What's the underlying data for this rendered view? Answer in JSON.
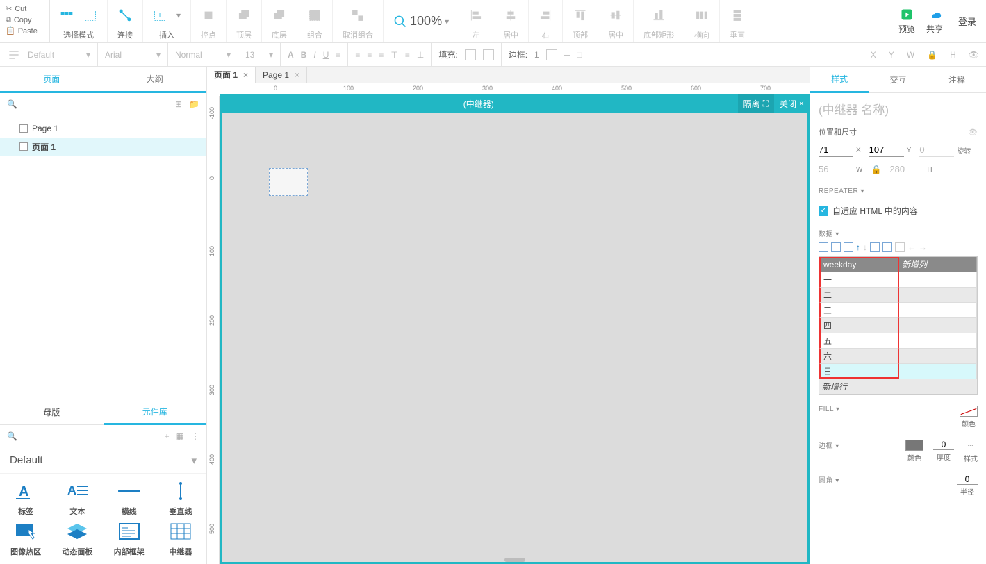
{
  "clipboard": {
    "cut": "Cut",
    "copy": "Copy",
    "paste": "Paste"
  },
  "toolbar": {
    "select_mode": "选择模式",
    "connect": "连接",
    "insert": "插入",
    "anchor": "控点",
    "top_layer": "顶层",
    "bottom_layer": "底层",
    "group": "组合",
    "ungroup": "取消组合",
    "zoom": "100%",
    "align_left": "左",
    "align_center_h": "居中",
    "align_right": "右",
    "align_top": "顶部",
    "align_center_v": "居中",
    "align_bottom": "底部矩形",
    "dist_h": "横向",
    "dist_v": "垂直",
    "preview": "预览",
    "share": "共享",
    "login": "登录"
  },
  "fmt": {
    "default": "Default",
    "font": "Arial",
    "weight": "Normal",
    "size": "13",
    "fill_label": "填充:",
    "border_label": "边框:",
    "border_width": "1",
    "x": "X",
    "y": "Y",
    "w": "W",
    "h": "H"
  },
  "left": {
    "pages_tab": "页面",
    "outline_tab": "大纲",
    "page1": "Page 1",
    "page1_cn": "页面 1",
    "masters_tab": "母版",
    "library_tab": "元件库",
    "lib_default": "Default",
    "widgets": [
      "标签",
      "文本",
      "横线",
      "垂直线",
      "图像热区",
      "动态面板",
      "内部框架",
      "中继器"
    ]
  },
  "canvas": {
    "tab1": "页面 1",
    "tab2": "Page 1",
    "title": "(中继器)",
    "isolate": "隔离",
    "close": "关闭"
  },
  "rulers": {
    "h": [
      "0",
      "100",
      "200",
      "300",
      "400",
      "500",
      "600",
      "700"
    ],
    "v": [
      "-100",
      "0",
      "100",
      "200",
      "300",
      "400",
      "500"
    ]
  },
  "right": {
    "tabs": [
      "样式",
      "交互",
      "注释"
    ],
    "widget_name": "(中继器 名称)",
    "pos_size": "位置和尺寸",
    "x": "71",
    "y": "107",
    "w": "56",
    "h": "280",
    "rot": "0",
    "xl": "X",
    "yl": "Y",
    "wl": "W",
    "hl": "H",
    "rotl": "旋转",
    "repeater": "REPEATER ▾",
    "adapt": "自适应 HTML 中的内容",
    "data": "数据 ▾",
    "col": "weekday",
    "new_col": "新增列",
    "rows": [
      "一",
      "二",
      "三",
      "四",
      "五",
      "六",
      "日"
    ],
    "new_row": "新增行",
    "fill": "FILL ▾",
    "color": "颜色",
    "border": "边框 ▾",
    "thickness": "厚度",
    "thickness_v": "0",
    "style": "样式",
    "corner": "圆角 ▾",
    "radius": "半径",
    "radius_v": "0"
  }
}
